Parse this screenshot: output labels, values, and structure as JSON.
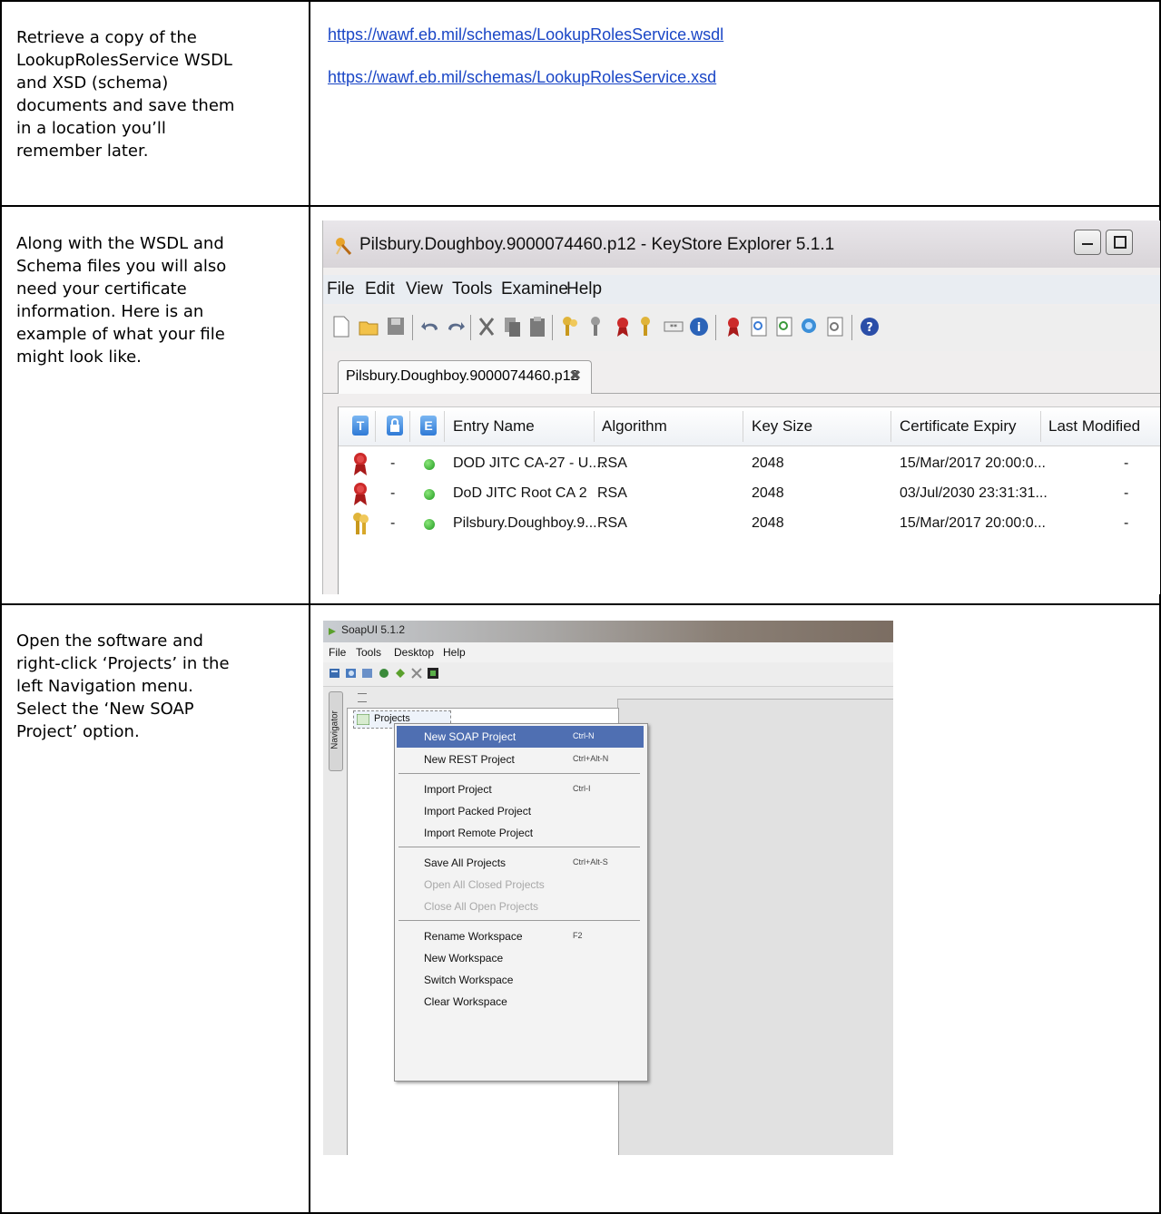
{
  "rows": [
    {
      "instruction": [
        "Retrieve a copy of the",
        "LookupRolesService WSDL",
        "and XSD (schema)",
        "documents and save them",
        "in a location you’ll",
        "remember later."
      ],
      "links": [
        "https://wawf.eb.mil/schemas/LookupRolesService.wsdl",
        "https://wawf.eb.mil/schemas/LookupRolesService.xsd"
      ]
    },
    {
      "instruction": [
        "Along with the WSDL and",
        "Schema files you will also",
        "need your certificate",
        "information.  Here is an",
        "example of what your file",
        "might look like."
      ]
    },
    {
      "instruction": [
        "Open the software and",
        "right-click ‘Projects’ in the",
        "left Navigation menu.",
        "Select the ‘New SOAP",
        "Project’ option."
      ]
    }
  ],
  "keystore": {
    "title": "Pilsbury.Doughboy.9000074460.p12 - KeyStore Explorer 5.1.1",
    "menu": [
      "File",
      "Edit",
      "View",
      "Tools",
      "Examine",
      "Help"
    ],
    "tab": "Pilsbury.Doughboy.9000074460.p12",
    "tab_close": "✖",
    "badges": [
      "T",
      "E"
    ],
    "columns": [
      "Entry Name",
      "Algorithm",
      "Key Size",
      "Certificate Expiry",
      "Last Modified"
    ],
    "entries": [
      {
        "type": "certificate",
        "lock": "-",
        "name": "DOD JITC CA-27 - U....",
        "algorithm": "RSA",
        "key_size": "2048",
        "expiry": "15/Mar/2017 20:00:0...",
        "modified": "-"
      },
      {
        "type": "certificate",
        "lock": "-",
        "name": "DoD JITC Root CA 2",
        "algorithm": "RSA",
        "key_size": "2048",
        "expiry": "03/Jul/2030 23:31:31...",
        "modified": "-"
      },
      {
        "type": "key-pair",
        "lock": "-",
        "name": "Pilsbury.Doughboy.9...",
        "algorithm": "RSA",
        "key_size": "2048",
        "expiry": "15/Mar/2017 20:00:0...",
        "modified": "-"
      }
    ]
  },
  "soapui": {
    "title": "SoapUI 5.1.2",
    "menu": [
      "File",
      "Tools",
      "Desktop",
      "Help"
    ],
    "navigator_label": "Navigator",
    "tree_node": "Projects",
    "context_menu": [
      {
        "label": "New SOAP Project",
        "shortcut": "Ctrl-N",
        "state": "highlighted"
      },
      {
        "label": "New REST Project",
        "shortcut": "Ctrl+Alt-N",
        "state": "normal"
      },
      {
        "label": "Import Project",
        "shortcut": "Ctrl-I",
        "state": "normal"
      },
      {
        "label": "Import Packed Project",
        "shortcut": "",
        "state": "normal"
      },
      {
        "label": "Import Remote Project",
        "shortcut": "",
        "state": "normal"
      },
      {
        "label": "Save All Projects",
        "shortcut": "Ctrl+Alt-S",
        "state": "normal"
      },
      {
        "label": "Open All Closed Projects",
        "shortcut": "",
        "state": "disabled"
      },
      {
        "label": "Close All Open Projects",
        "shortcut": "",
        "state": "disabled"
      },
      {
        "label": "Rename Workspace",
        "shortcut": "F2",
        "state": "normal"
      },
      {
        "label": "New Workspace",
        "shortcut": "",
        "state": "normal"
      },
      {
        "label": "Switch Workspace",
        "shortcut": "",
        "state": "normal"
      },
      {
        "label": "Clear Workspace",
        "shortcut": "",
        "state": "normal"
      }
    ]
  }
}
